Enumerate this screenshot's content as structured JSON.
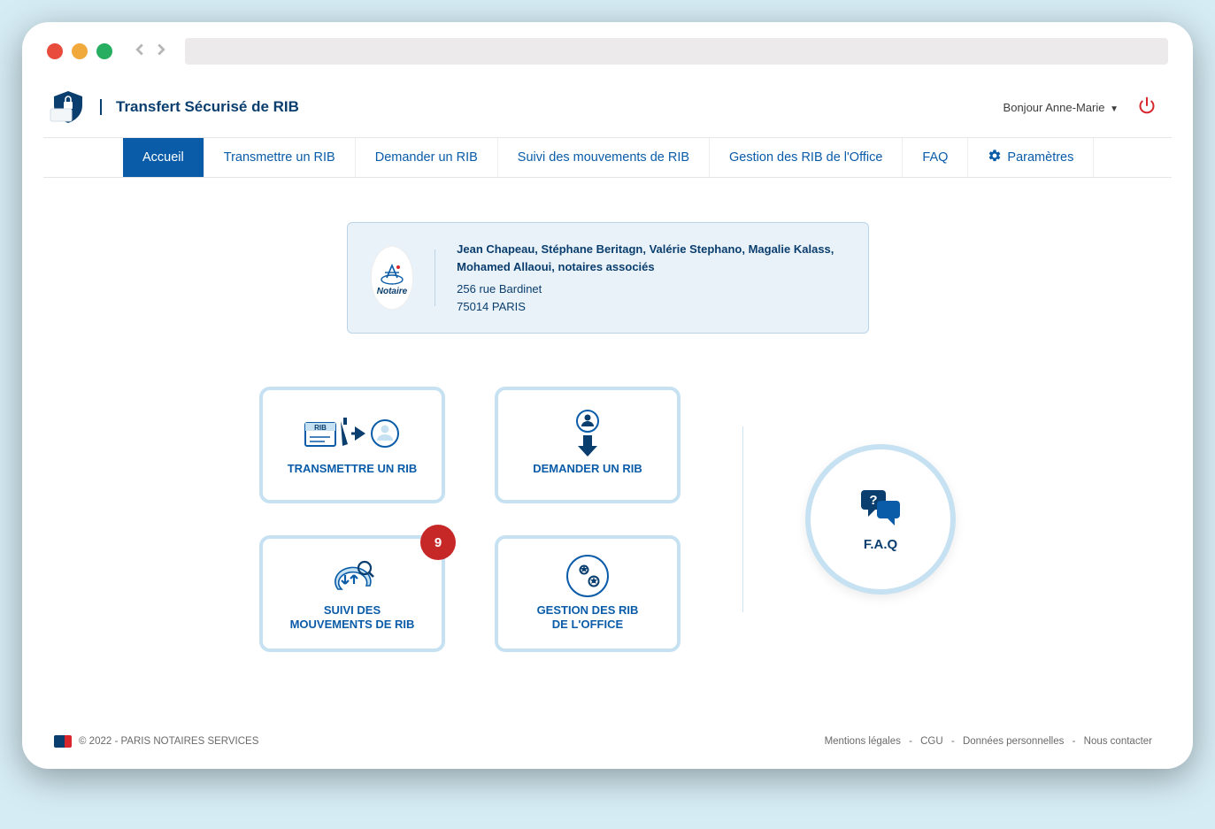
{
  "app": {
    "title": "Transfert Sécurisé de RIB"
  },
  "header": {
    "greeting_prefix": "Bonjour",
    "user_name": "Anne-Marie"
  },
  "nav": {
    "items": [
      {
        "label": "Accueil",
        "active": true
      },
      {
        "label": "Transmettre un RIB"
      },
      {
        "label": "Demander un RIB"
      },
      {
        "label": "Suivi des mouvements de RIB"
      },
      {
        "label": "Gestion des RIB de l'Office"
      },
      {
        "label": "FAQ"
      },
      {
        "label": "Paramètres",
        "icon": "gear"
      }
    ]
  },
  "office": {
    "logo_label": "Notaire",
    "names": "Jean Chapeau, Stéphane Beritagn, Valérie Stephano, Magalie Kalass, Mohamed Allaoui, notaires associés",
    "address_line1": "256 rue Bardinet",
    "address_line2": "75014 PARIS"
  },
  "tiles": {
    "transmettre": "TRANSMETTRE UN RIB",
    "demander": "DEMANDER UN RIB",
    "suivi_line1": "SUIVI DES",
    "suivi_line2": "MOUVEMENTS DE RIB",
    "suivi_badge": "9",
    "gestion_line1": "GESTION DES RIB",
    "gestion_line2": "DE L'OFFICE",
    "faq": "F.A.Q"
  },
  "footer": {
    "copyright": "© 2022 - PARIS NOTAIRES SERVICES",
    "links": {
      "mentions": "Mentions légales",
      "cgu": "CGU",
      "donnees": "Données personnelles",
      "contact": "Nous contacter"
    }
  },
  "colors": {
    "primary": "#0a5ca8",
    "dark": "#0a3e6e",
    "accent_red": "#c62828",
    "light_border": "#c6e1f2"
  }
}
